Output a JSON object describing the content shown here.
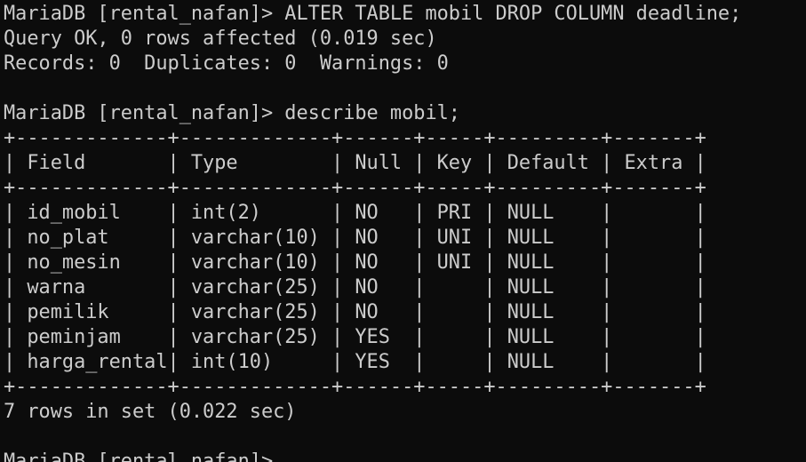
{
  "terminal": {
    "lines": [
      "MariaDB [rental_nafan]> ALTER TABLE mobil DROP COLUMN deadline;",
      "Query OK, 0 rows affected (0.019 sec)",
      "Records: 0  Duplicates: 0  Warnings: 0",
      "",
      "MariaDB [rental_nafan]> describe mobil;",
      "+-------------+-------------+------+-----+---------+-------+",
      "| Field       | Type        | Null | Key | Default | Extra |",
      "+-------------+-------------+------+-----+---------+-------+",
      "| id_mobil    | int(2)      | NO   | PRI | NULL    |       |",
      "| no_plat     | varchar(10) | NO   | UNI | NULL    |       |",
      "| no_mesin    | varchar(10) | NO   | UNI | NULL    |       |",
      "| warna       | varchar(25) | NO   |     | NULL    |       |",
      "| pemilik     | varchar(25) | NO   |     | NULL    |       |",
      "| peminjam    | varchar(25) | YES  |     | NULL    |       |",
      "| harga_rental| int(10)     | YES  |     | NULL    |       |",
      "+-------------+-------------+------+-----+---------+-------+",
      "7 rows in set (0.022 sec)",
      "",
      "MariaDB [rental_nafan]>"
    ]
  }
}
